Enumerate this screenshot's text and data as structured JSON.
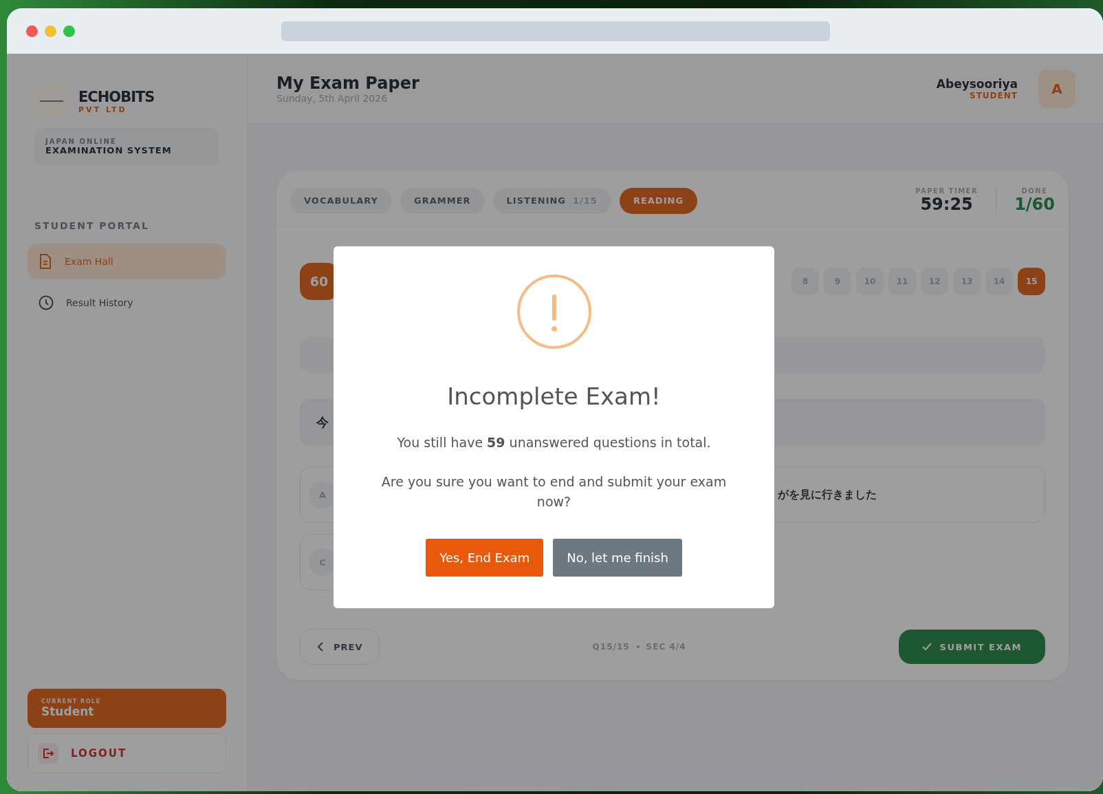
{
  "sidebar": {
    "brand": {
      "name": "ECHOBITS",
      "sub": "PVT LTD"
    },
    "system": {
      "line1": "JAPAN ONLINE",
      "line2": "EXAMINATION SYSTEM"
    },
    "section": "STUDENT PORTAL",
    "items": [
      {
        "label": "Exam Hall",
        "kind": "document",
        "selected": true
      },
      {
        "label": "Result History",
        "kind": "clock",
        "selected": false
      }
    ],
    "role": {
      "caption": "CURRENT ROLE",
      "value": "Student"
    },
    "logout": "LOGOUT"
  },
  "header": {
    "title": "My Exam Paper",
    "date": "Sunday, 5th April 2026",
    "user": "Abeysooriya",
    "role": "STUDENT",
    "avatar": "A"
  },
  "tabs": [
    {
      "label": "VOCABULARY",
      "selected": false
    },
    {
      "label": "GRAMMER",
      "selected": false
    },
    {
      "label": "LISTENING",
      "count": "1/15",
      "selected": false
    },
    {
      "label": "READING",
      "selected": true
    }
  ],
  "timer": {
    "label": "PAPER TIMER",
    "value": "59:25"
  },
  "done": {
    "label": "DONE",
    "value": "1/60"
  },
  "remaining_badge": "60",
  "question_numbers": [
    {
      "label": "8",
      "selected": false
    },
    {
      "label": "9",
      "selected": false
    },
    {
      "label": "10",
      "selected": false
    },
    {
      "label": "11",
      "selected": false
    },
    {
      "label": "12",
      "selected": false
    },
    {
      "label": "13",
      "selected": false
    },
    {
      "label": "14",
      "selected": false
    },
    {
      "label": "15",
      "selected": true
    }
  ],
  "question_text": "今",
  "options": [
    {
      "label": "A"
    },
    {
      "text": "がを見に行きました"
    },
    {
      "label": "C"
    }
  ],
  "footer": {
    "prev": "PREV",
    "position": "Q15/15",
    "section": "SEC 4/4",
    "submit": "SUBMIT EXAM"
  },
  "dialog": {
    "title": "Incomplete Exam!",
    "message": "You still have **59** unanswered questions in total.",
    "question": "Are you sure you want to end and submit your exam now?",
    "confirm": "Yes, End Exam",
    "cancel": "No, let me finish"
  }
}
